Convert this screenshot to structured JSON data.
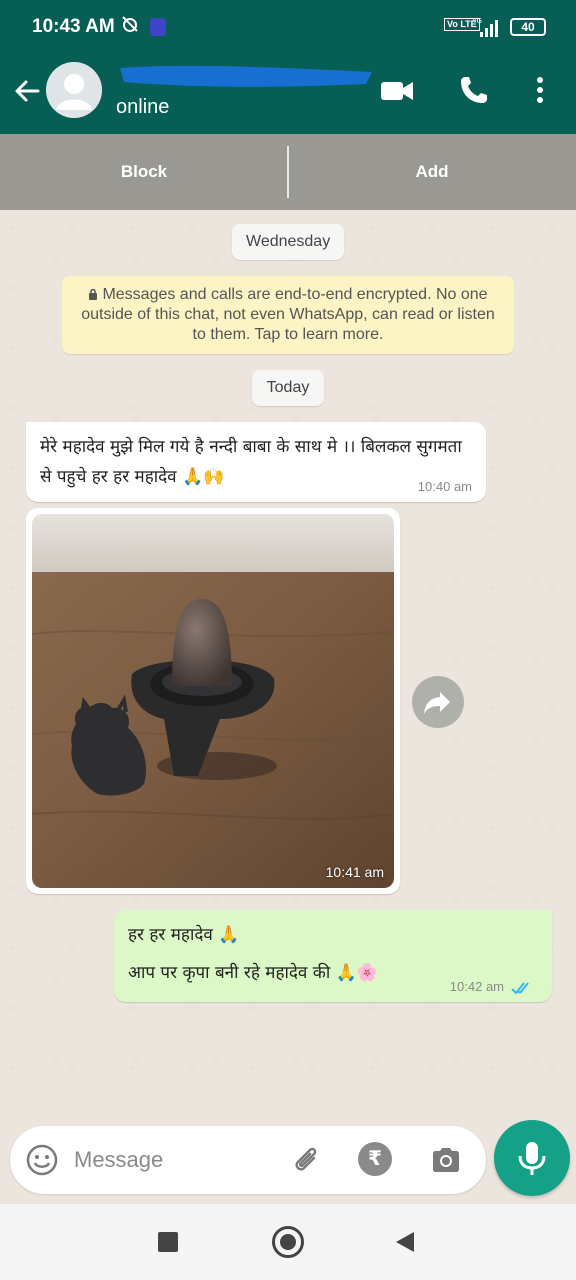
{
  "status_bar": {
    "time": "10:43 AM",
    "network": "4G",
    "volte_label": "Vo LTE",
    "battery": "40"
  },
  "header": {
    "contact_status": "online",
    "back_icon": "arrow-left-icon",
    "video_icon": "video-call-icon",
    "call_icon": "phone-icon",
    "menu_icon": "more-vert-icon"
  },
  "actions": {
    "block_label": "Block",
    "add_label": "Add"
  },
  "chat": {
    "date_chip_1": "Wednesday",
    "encryption_notice": "Messages and calls are end-to-end encrypted. No one outside of this chat, not even WhatsApp, can read or listen to them. Tap to learn more.",
    "date_chip_2": "Today",
    "messages": [
      {
        "direction": "incoming",
        "text": "मेरे महादेव मुझे मिल गये है नन्दी बाबा के साथ मे ।। बिलकल सुगमता से पहुचे   हर हर महादेव 🙏🙌",
        "time": "10:40 am"
      },
      {
        "direction": "incoming",
        "type": "image",
        "time": "10:41 am"
      },
      {
        "direction": "outgoing",
        "line1": "हर हर महादेव 🙏",
        "line2": "आप पर कृपा बनी रहे महादेव  की 🙏🌸",
        "time": "10:42 am",
        "status": "read"
      }
    ]
  },
  "composer": {
    "placeholder": "Message",
    "rupee_symbol": "₹"
  },
  "colors": {
    "header": "#075e54",
    "outgoing_bubble": "#dcf8c6",
    "mic_button": "#15a088",
    "read_ticks": "#34b7f1"
  }
}
